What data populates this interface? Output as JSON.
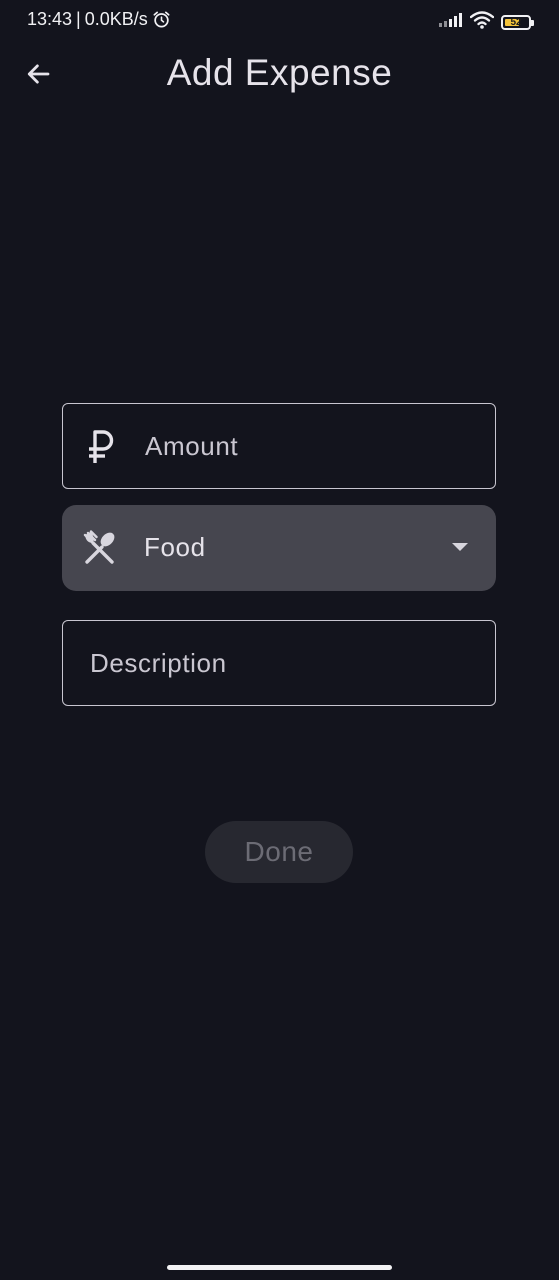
{
  "status_bar": {
    "time": "13:43",
    "separator": "|",
    "network_speed": "0.0KB/s",
    "battery_level": "52",
    "icons": [
      "alarm-icon",
      "signal-icon",
      "wifi-icon",
      "battery-icon"
    ]
  },
  "app_bar": {
    "title": "Add Expense",
    "back_icon": "arrow-back-icon"
  },
  "form": {
    "amount": {
      "placeholder": "Amount",
      "value": "",
      "icon": "ruble-icon"
    },
    "category": {
      "selected": "Food",
      "icon": "fork-spoon-icon",
      "dropdown_icon": "dropdown-arrow-icon"
    },
    "description": {
      "placeholder": "Description",
      "value": ""
    },
    "done_label": "Done"
  },
  "colors": {
    "background": "#13141d",
    "text": "#e6e3ea",
    "outline": "#c8c6d0",
    "selected_field": "#46464f",
    "battery_fill": "#f2c23a",
    "button_disabled_bg": "#272830",
    "button_disabled_text": "#6c6c75"
  }
}
